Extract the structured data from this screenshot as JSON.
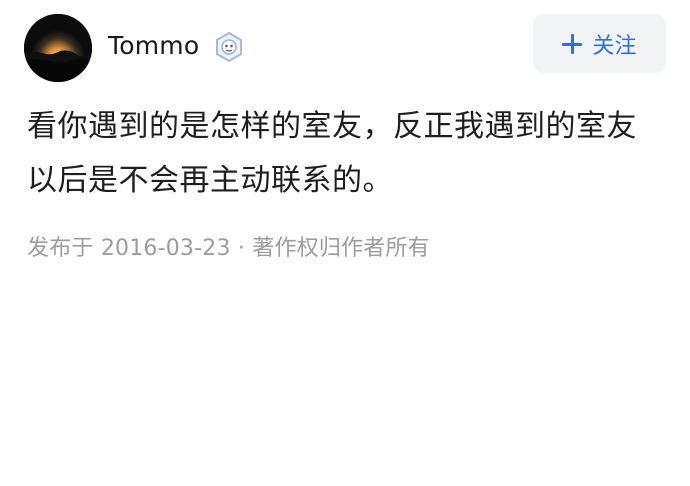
{
  "author": {
    "name": "Tommo",
    "avatar_icon": "night-landscape-avatar",
    "badge_icon": "verified-badge-icon"
  },
  "follow_button": {
    "icon": "plus-icon",
    "label": "关注",
    "color": "#2f6fe0"
  },
  "post": {
    "line1": "看你遇到的是怎样的室友，反正我遇到的室友",
    "line2": "以后是不会再主动联系的。"
  },
  "meta": {
    "published_prefix": "发布于",
    "date": "2016-03-23",
    "separator": "·",
    "copyright": "著作权归作者所有"
  }
}
